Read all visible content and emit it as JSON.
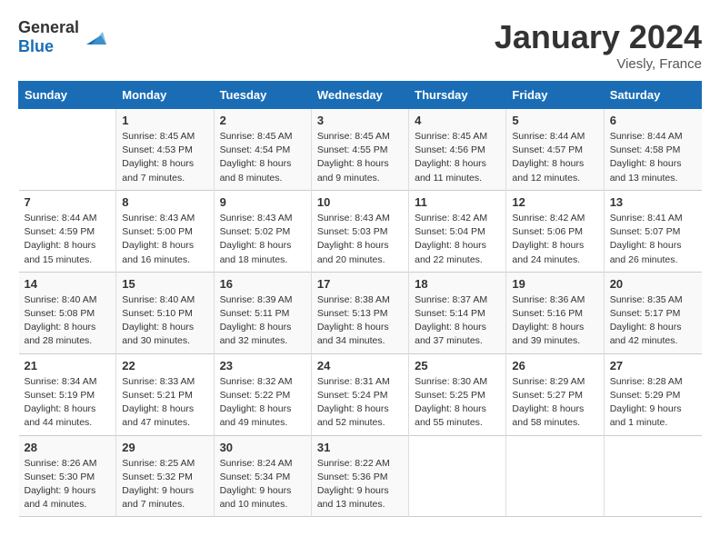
{
  "header": {
    "logo_general": "General",
    "logo_blue": "Blue",
    "month_title": "January 2024",
    "location": "Viesly, France"
  },
  "columns": [
    "Sunday",
    "Monday",
    "Tuesday",
    "Wednesday",
    "Thursday",
    "Friday",
    "Saturday"
  ],
  "weeks": [
    [
      {
        "day": "",
        "sunrise": "",
        "sunset": "",
        "daylight": ""
      },
      {
        "day": "1",
        "sunrise": "Sunrise: 8:45 AM",
        "sunset": "Sunset: 4:53 PM",
        "daylight": "Daylight: 8 hours and 7 minutes."
      },
      {
        "day": "2",
        "sunrise": "Sunrise: 8:45 AM",
        "sunset": "Sunset: 4:54 PM",
        "daylight": "Daylight: 8 hours and 8 minutes."
      },
      {
        "day": "3",
        "sunrise": "Sunrise: 8:45 AM",
        "sunset": "Sunset: 4:55 PM",
        "daylight": "Daylight: 8 hours and 9 minutes."
      },
      {
        "day": "4",
        "sunrise": "Sunrise: 8:45 AM",
        "sunset": "Sunset: 4:56 PM",
        "daylight": "Daylight: 8 hours and 11 minutes."
      },
      {
        "day": "5",
        "sunrise": "Sunrise: 8:44 AM",
        "sunset": "Sunset: 4:57 PM",
        "daylight": "Daylight: 8 hours and 12 minutes."
      },
      {
        "day": "6",
        "sunrise": "Sunrise: 8:44 AM",
        "sunset": "Sunset: 4:58 PM",
        "daylight": "Daylight: 8 hours and 13 minutes."
      }
    ],
    [
      {
        "day": "7",
        "sunrise": "Sunrise: 8:44 AM",
        "sunset": "Sunset: 4:59 PM",
        "daylight": "Daylight: 8 hours and 15 minutes."
      },
      {
        "day": "8",
        "sunrise": "Sunrise: 8:43 AM",
        "sunset": "Sunset: 5:00 PM",
        "daylight": "Daylight: 8 hours and 16 minutes."
      },
      {
        "day": "9",
        "sunrise": "Sunrise: 8:43 AM",
        "sunset": "Sunset: 5:02 PM",
        "daylight": "Daylight: 8 hours and 18 minutes."
      },
      {
        "day": "10",
        "sunrise": "Sunrise: 8:43 AM",
        "sunset": "Sunset: 5:03 PM",
        "daylight": "Daylight: 8 hours and 20 minutes."
      },
      {
        "day": "11",
        "sunrise": "Sunrise: 8:42 AM",
        "sunset": "Sunset: 5:04 PM",
        "daylight": "Daylight: 8 hours and 22 minutes."
      },
      {
        "day": "12",
        "sunrise": "Sunrise: 8:42 AM",
        "sunset": "Sunset: 5:06 PM",
        "daylight": "Daylight: 8 hours and 24 minutes."
      },
      {
        "day": "13",
        "sunrise": "Sunrise: 8:41 AM",
        "sunset": "Sunset: 5:07 PM",
        "daylight": "Daylight: 8 hours and 26 minutes."
      }
    ],
    [
      {
        "day": "14",
        "sunrise": "Sunrise: 8:40 AM",
        "sunset": "Sunset: 5:08 PM",
        "daylight": "Daylight: 8 hours and 28 minutes."
      },
      {
        "day": "15",
        "sunrise": "Sunrise: 8:40 AM",
        "sunset": "Sunset: 5:10 PM",
        "daylight": "Daylight: 8 hours and 30 minutes."
      },
      {
        "day": "16",
        "sunrise": "Sunrise: 8:39 AM",
        "sunset": "Sunset: 5:11 PM",
        "daylight": "Daylight: 8 hours and 32 minutes."
      },
      {
        "day": "17",
        "sunrise": "Sunrise: 8:38 AM",
        "sunset": "Sunset: 5:13 PM",
        "daylight": "Daylight: 8 hours and 34 minutes."
      },
      {
        "day": "18",
        "sunrise": "Sunrise: 8:37 AM",
        "sunset": "Sunset: 5:14 PM",
        "daylight": "Daylight: 8 hours and 37 minutes."
      },
      {
        "day": "19",
        "sunrise": "Sunrise: 8:36 AM",
        "sunset": "Sunset: 5:16 PM",
        "daylight": "Daylight: 8 hours and 39 minutes."
      },
      {
        "day": "20",
        "sunrise": "Sunrise: 8:35 AM",
        "sunset": "Sunset: 5:17 PM",
        "daylight": "Daylight: 8 hours and 42 minutes."
      }
    ],
    [
      {
        "day": "21",
        "sunrise": "Sunrise: 8:34 AM",
        "sunset": "Sunset: 5:19 PM",
        "daylight": "Daylight: 8 hours and 44 minutes."
      },
      {
        "day": "22",
        "sunrise": "Sunrise: 8:33 AM",
        "sunset": "Sunset: 5:21 PM",
        "daylight": "Daylight: 8 hours and 47 minutes."
      },
      {
        "day": "23",
        "sunrise": "Sunrise: 8:32 AM",
        "sunset": "Sunset: 5:22 PM",
        "daylight": "Daylight: 8 hours and 49 minutes."
      },
      {
        "day": "24",
        "sunrise": "Sunrise: 8:31 AM",
        "sunset": "Sunset: 5:24 PM",
        "daylight": "Daylight: 8 hours and 52 minutes."
      },
      {
        "day": "25",
        "sunrise": "Sunrise: 8:30 AM",
        "sunset": "Sunset: 5:25 PM",
        "daylight": "Daylight: 8 hours and 55 minutes."
      },
      {
        "day": "26",
        "sunrise": "Sunrise: 8:29 AM",
        "sunset": "Sunset: 5:27 PM",
        "daylight": "Daylight: 8 hours and 58 minutes."
      },
      {
        "day": "27",
        "sunrise": "Sunrise: 8:28 AM",
        "sunset": "Sunset: 5:29 PM",
        "daylight": "Daylight: 9 hours and 1 minute."
      }
    ],
    [
      {
        "day": "28",
        "sunrise": "Sunrise: 8:26 AM",
        "sunset": "Sunset: 5:30 PM",
        "daylight": "Daylight: 9 hours and 4 minutes."
      },
      {
        "day": "29",
        "sunrise": "Sunrise: 8:25 AM",
        "sunset": "Sunset: 5:32 PM",
        "daylight": "Daylight: 9 hours and 7 minutes."
      },
      {
        "day": "30",
        "sunrise": "Sunrise: 8:24 AM",
        "sunset": "Sunset: 5:34 PM",
        "daylight": "Daylight: 9 hours and 10 minutes."
      },
      {
        "day": "31",
        "sunrise": "Sunrise: 8:22 AM",
        "sunset": "Sunset: 5:36 PM",
        "daylight": "Daylight: 9 hours and 13 minutes."
      },
      {
        "day": "",
        "sunrise": "",
        "sunset": "",
        "daylight": ""
      },
      {
        "day": "",
        "sunrise": "",
        "sunset": "",
        "daylight": ""
      },
      {
        "day": "",
        "sunrise": "",
        "sunset": "",
        "daylight": ""
      }
    ]
  ]
}
